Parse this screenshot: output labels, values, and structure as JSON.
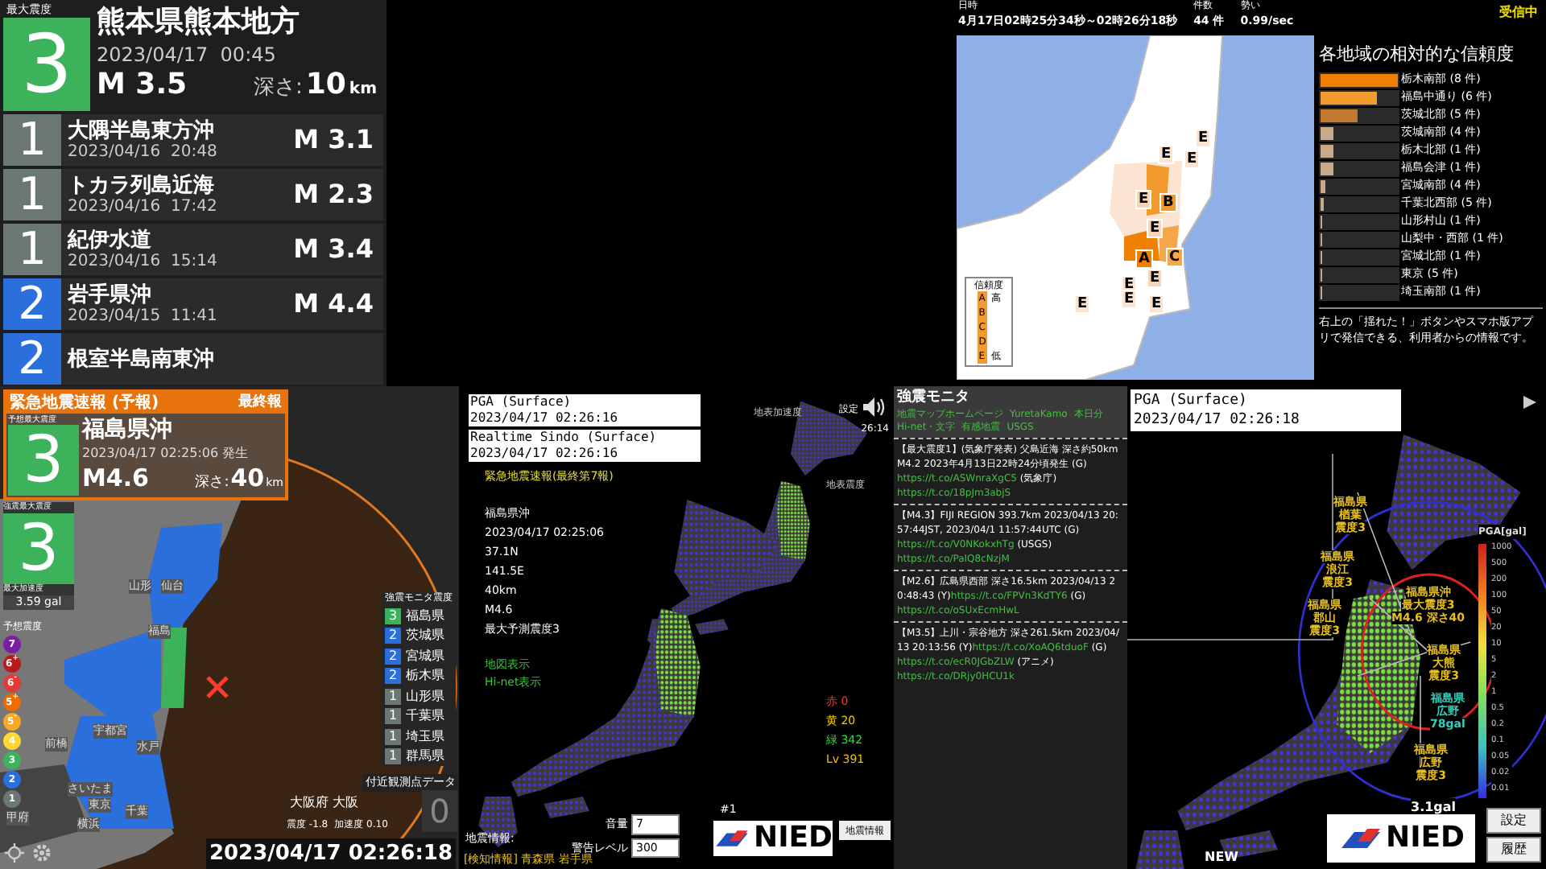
{
  "latest": {
    "label": "最大震度",
    "intensity": "3",
    "region": "熊本県熊本地方",
    "time": "2023/04/17  00:45",
    "magnitude": "M 3.5",
    "depth_label": "深さ:",
    "depth": "10",
    "depth_unit": "km"
  },
  "quake_list": [
    {
      "intensity": "1",
      "color": "#6b7774",
      "region": "大隅半島東方沖",
      "time": "2023/04/16  20:48",
      "magnitude": "M 3.1"
    },
    {
      "intensity": "1",
      "color": "#6b7774",
      "region": "トカラ列島近海",
      "time": "2023/04/16  17:42",
      "magnitude": "M 2.3"
    },
    {
      "intensity": "1",
      "color": "#6b7774",
      "region": "紀伊水道",
      "time": "2023/04/16  15:14",
      "magnitude": "M 3.4"
    },
    {
      "intensity": "2",
      "color": "#2a6fdb",
      "region": "岩手県沖",
      "time": "2023/04/15  11:41",
      "magnitude": "M 4.4"
    },
    {
      "intensity": "2",
      "color": "#2a6fdb",
      "region": "根室半島南東沖"
    }
  ],
  "reports": {
    "header": [
      {
        "label": "日時",
        "value": "4月17日02時25分34秒～02時26分18秒"
      },
      {
        "label": "件数",
        "value": "44 件"
      },
      {
        "label": "勢い",
        "value": "0.99/sec"
      }
    ],
    "status": "受信中",
    "map_labels": [
      {
        "text": "E",
        "color": "#fbe5d2"
      },
      {
        "text": "E",
        "color": "#fbe5d2"
      },
      {
        "text": "E",
        "color": "#fbe5d2"
      },
      {
        "text": "E",
        "color": "#f6d4b4"
      },
      {
        "text": "B",
        "color": "#f39a2e"
      },
      {
        "text": "E",
        "color": "#f6d4b4"
      },
      {
        "text": "A",
        "color": "#f08000"
      },
      {
        "text": "C",
        "color": "#f5a54a"
      },
      {
        "text": "E",
        "color": "#f6d4b4"
      },
      {
        "text": "E",
        "color": "#fbe5d2"
      },
      {
        "text": "E",
        "color": "#fbe5d2"
      },
      {
        "text": "E",
        "color": "#fbe5d2"
      },
      {
        "text": "E",
        "color": "#fbe5d2"
      }
    ],
    "legend": {
      "title": "信頼度",
      "grades": [
        "A",
        "B",
        "C",
        "D",
        "E"
      ],
      "high": "高",
      "low": "低"
    },
    "ranking_title": "各地域の相対的な信頼度",
    "ranking": [
      {
        "label": "栃木南部 (8 件)",
        "level": 1,
        "color": "#f08000"
      },
      {
        "label": "福島中通り (6 件)",
        "level": 0.73,
        "color": "#f39a2e"
      },
      {
        "label": "茨城北部 (5 件)",
        "level": 0.47,
        "color": "#c47a30"
      },
      {
        "label": "茨城南部 (4 件)",
        "level": 0.16,
        "color": "#c8a98a"
      },
      {
        "label": "栃木北部 (1 件)",
        "level": 0.16,
        "color": "#c8a98a"
      },
      {
        "label": "福島会津 (1 件)",
        "level": 0.16,
        "color": "#c8a98a"
      },
      {
        "label": "宮城南部 (4 件)",
        "level": 0.06,
        "color": "#c8a98a"
      },
      {
        "label": "千葉北西部 (5 件)",
        "level": 0.04,
        "color": "#c8a98a"
      },
      {
        "label": "山形村山 (1 件)",
        "level": 0.03,
        "color": "#c8a98a"
      },
      {
        "label": "山梨中・西部 (1 件)",
        "level": 0.02,
        "color": "#c8a98a"
      },
      {
        "label": "宮城北部 (1 件)",
        "level": 0.02,
        "color": "#c8a98a"
      },
      {
        "label": "東京 (5 件)",
        "level": 0.02,
        "color": "#c8a98a"
      },
      {
        "label": "埼玉南部 (1 件)",
        "level": 0.02,
        "color": "#c8a98a"
      }
    ],
    "note": "右上の「揺れた！」ボタンやスマホ版アプリで発信できる、利用者からの情報です。"
  },
  "eew": {
    "title": "緊急地震速報 (予報)",
    "report": "最終報",
    "forecast_label": "予想最大震度",
    "forecast_intensity": "3",
    "region": "福島県沖",
    "time": "2023/04/17 02:25:06 発生",
    "magnitude": "M4.6",
    "depth_label": "深さ:",
    "depth": "40",
    "depth_unit": "km",
    "observed_label": "強震最大震度",
    "observed_intensity": "3",
    "pga_label": "最大加速度",
    "pga": "3.59 gal",
    "scale_title": "予想震度",
    "scale": [
      {
        "label": "7",
        "color": "#7b1fa2"
      },
      {
        "label": "6$^{+}$",
        "color": "#b71c1c"
      },
      {
        "label": "6$^{-}$",
        "color": "#e53935"
      },
      {
        "label": "5$^{+}$",
        "color": "#ef6c00"
      },
      {
        "label": "5$^{-}$",
        "color": "#f9a825"
      },
      {
        "label": "4",
        "color": "#fdd835"
      },
      {
        "label": "3",
        "color": "#3cb35a"
      },
      {
        "label": "2",
        "color": "#2a6fdb"
      },
      {
        "label": "1",
        "color": "#6b7774"
      }
    ],
    "city_labels": [
      "山形",
      "仙台",
      "福島",
      "宇都宮",
      "水戸",
      "前橋",
      "さいたま",
      "東京",
      "千葉",
      "横浜",
      "甲府"
    ],
    "monitor_title": "強震モニタ震度",
    "monitor": [
      {
        "intensity": "3",
        "color": "#3cb35a",
        "pref": "福島県"
      },
      {
        "intensity": "2",
        "color": "#2a6fdb",
        "pref": "茨城県"
      },
      {
        "intensity": "2",
        "color": "#2a6fdb",
        "pref": "宮城県"
      },
      {
        "intensity": "2",
        "color": "#2a6fdb",
        "pref": "栃木県"
      },
      {
        "intensity": "1",
        "color": "#6b7774",
        "pref": "山形県"
      },
      {
        "intensity": "1",
        "color": "#6b7774",
        "pref": "千葉県"
      },
      {
        "intensity": "1",
        "color": "#6b7774",
        "pref": "埼玉県"
      },
      {
        "intensity": "1",
        "color": "#6b7774",
        "pref": "群馬県"
      }
    ],
    "nearby_title": "付近観測点データ",
    "nearby_station": "大阪府 大阪",
    "nearby_intensity_label": "震度",
    "nearby_intensity": "-1.8",
    "nearby_accel_label": "加速度",
    "nearby_accel": "0.10",
    "nearby_value": "0",
    "clock": "2023/04/17 02:26:18"
  },
  "kmoni": {
    "pga_title": "PGA (Surface)",
    "pga_time": "2023/04/17 02:26:16",
    "sindo_title": "Realtime Sindo (Surface)",
    "sindo_time": "2023/04/17 02:26:16",
    "settings": "設定",
    "elapsed": "26:14",
    "map_titles": [
      "地表加速度",
      "地表震度"
    ],
    "eew_title": "緊急地震速報(最終第7報)",
    "eew_lines": [
      "福島県沖",
      "2023/04/17 02:25:06",
      "37.1N",
      "141.5E",
      "40km",
      "M4.6",
      "最大予測震度3"
    ],
    "links": [
      "地図表示",
      "Hi-net表示"
    ],
    "counts": [
      {
        "label": "赤 0",
        "color": "#ff3030"
      },
      {
        "label": "黄 20",
        "color": "#f0d000"
      },
      {
        "label": "緑 342",
        "color": "#30e030"
      },
      {
        "label": "Lv 391",
        "color": "#f0c000"
      }
    ],
    "page": "#1",
    "volume_label": "音量",
    "volume": "7",
    "alert_label": "警告レベル",
    "alert": "300",
    "logo": "NIED",
    "quake_button": "地震情報",
    "info_label": "地震情報:",
    "detect": "[検知情報] 青森県 岩手県"
  },
  "feed": {
    "title": "強震モニタ",
    "links": [
      "地震マップホームページ",
      "YuretaKamo",
      "本日分",
      "Hi-net・文字",
      "有感地震",
      "USGS"
    ],
    "posts": [
      [
        {
          "kind": "text",
          "text": "【最大震度1】(気象庁発表) 父島近海 深さ約50km M4.2 2023年4月13日22時24分頃発生 (G)"
        },
        {
          "kind": "link",
          "text": "https://t.co/ASWnraXgC5"
        },
        {
          "kind": "text",
          "text": " (気象庁)"
        },
        {
          "kind": "link",
          "text": "https://t.co/18pJm3abjS"
        }
      ],
      [
        {
          "kind": "text",
          "text": "【M4.3】FIJI REGION 393.7km 2023/04/13 20:57:44JST, 2023/04/1 11:57:44UTC (G)"
        },
        {
          "kind": "link",
          "text": "https://t.co/V0NKokxhTg"
        },
        {
          "kind": "text",
          "text": " (USGS)"
        },
        {
          "kind": "link",
          "text": "https://t.co/PaIQ8cNzjM"
        }
      ],
      [
        {
          "kind": "text",
          "text": "【M2.6】広島県西部 深さ16.5km 2023/04/13 20:48:43 (Y)"
        },
        {
          "kind": "link",
          "text": "https://t.co/FPVn3KdTY6"
        },
        {
          "kind": "text",
          "text": " (G)"
        },
        {
          "kind": "link",
          "text": "https://t.co/oSUxEcmHwL"
        }
      ],
      [
        {
          "kind": "text",
          "text": "【M3.5】上川・宗谷地方 深さ261.5km 2023/04/13 20:13:56 (Y)"
        },
        {
          "kind": "link",
          "text": "https://t.co/XoAQ6tduoF"
        },
        {
          "kind": "text",
          "text": " (G)"
        },
        {
          "kind": "link",
          "text": "https://t.co/ecR0JGbZLW"
        },
        {
          "kind": "text",
          "text": " (アニメ)"
        },
        {
          "kind": "link",
          "text": "https://t.co/DRjy0HCU1k"
        }
      ]
    ]
  },
  "pga_map": {
    "title": "PGA (Surface)",
    "time": "2023/04/17 02:26:18",
    "labels": [
      {
        "lines": [
          "福島県",
          "楢葉",
          "震度3"
        ],
        "color": "#e8c020"
      },
      {
        "lines": [
          "福島県",
          "浪江",
          "震度3"
        ],
        "color": "#e8c020"
      },
      {
        "lines": [
          "福島県",
          "郡山",
          "震度3"
        ],
        "color": "#e8c020"
      },
      {
        "lines": [
          "福島県沖",
          "最大震度3",
          "M4.6 深さ40"
        ],
        "color": "#e8c020"
      },
      {
        "lines": [
          "福島県",
          "大熊",
          "震度3"
        ],
        "color": "#e8c020"
      },
      {
        "lines": [
          "福島県",
          "広野",
          "78gal"
        ],
        "color": "#30d0c0"
      },
      {
        "lines": [
          "福島県",
          "広野",
          "震度3"
        ],
        "color": "#e8c020"
      }
    ],
    "scale_title": "PGA[gal]",
    "scale_ticks": [
      "1000",
      "500",
      "200",
      "100",
      "50",
      "20",
      "10",
      "5",
      "2",
      "1",
      "0.5",
      "0.2",
      "0.1",
      "0.05",
      "0.02",
      "0.01"
    ],
    "min_reading": "3.1gal",
    "new": "NEW",
    "logo": "NIED",
    "buttons": [
      "設定",
      "履歴"
    ]
  }
}
